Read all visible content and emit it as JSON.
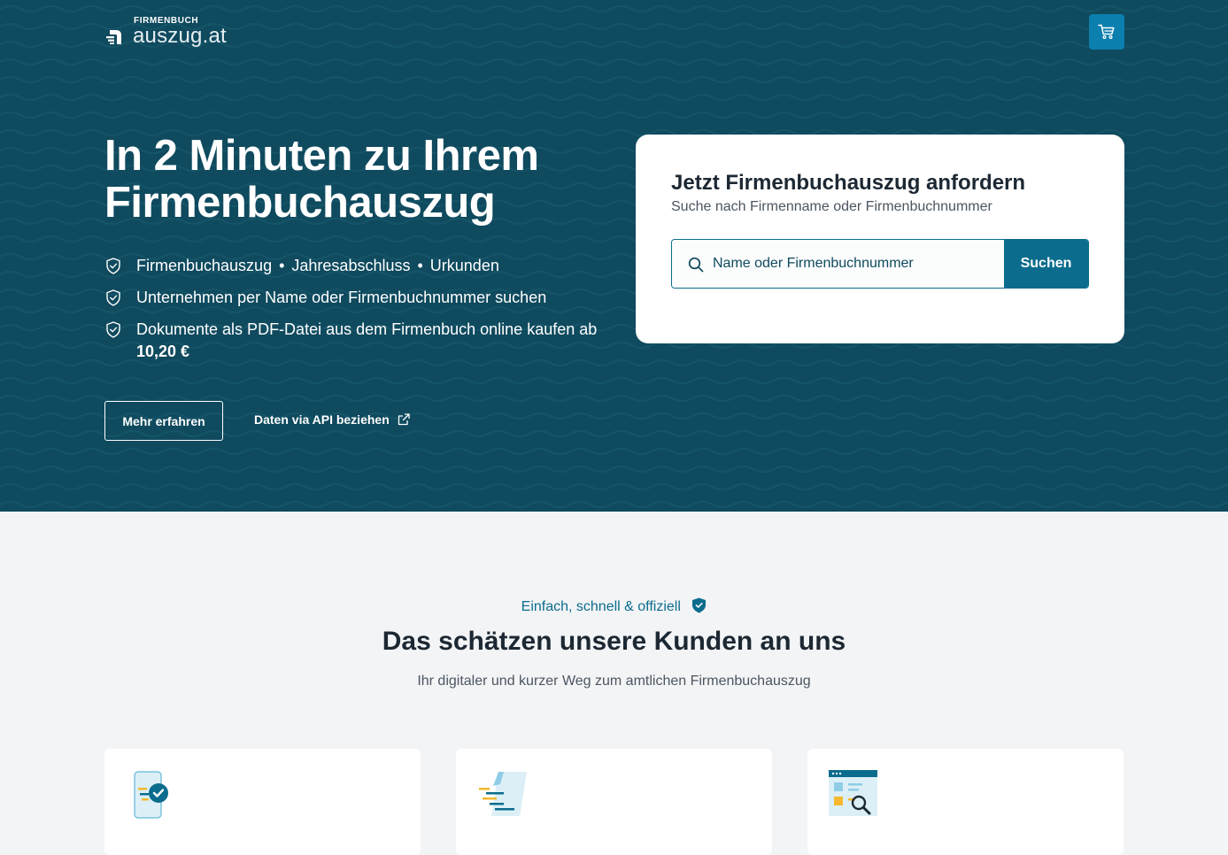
{
  "header": {
    "logo_small": "FIRMENBUCH",
    "logo_big": "auszug.at",
    "cart_icon": "shopping-cart-icon"
  },
  "hero": {
    "title_line1": "In 2 Minuten zu Ihrem",
    "title_line2": "Firmenbuchauszug",
    "features": [
      {
        "parts": [
          "Firmenbuchauszug",
          "Jahresabschluss",
          "Urkunden"
        ],
        "separator": "•"
      },
      {
        "text": "Unternehmen per Name oder Firmenbuchnummer suchen"
      },
      {
        "text": "Dokumente als PDF-Datei aus dem Firmenbuch online kaufen ab ",
        "price": "10,20 €"
      }
    ],
    "feature_icon": "shield-check-icon",
    "more_button": "Mehr erfahren",
    "api_link": "Daten via API beziehen",
    "api_link_icon": "external-link-icon"
  },
  "search_card": {
    "title": "Jetzt Firmenbuchauszug anfordern",
    "subtitle": "Suche nach Firmenname oder Firmenbuchnummer",
    "placeholder": "Name oder Firmenbuchnummer",
    "value": "",
    "button": "Suchen",
    "search_icon": "search-icon"
  },
  "section": {
    "eyebrow": "Einfach, schnell & offiziell",
    "eyebrow_icon": "shield-check-icon",
    "title": "Das schätzen unsere Kunden an uns",
    "subtitle": "Ihr digitaler und kurzer Weg zum amtlichen Firmenbuchauszug",
    "cards": [
      {
        "icon": "phone-check-icon"
      },
      {
        "icon": "fast-document-icon"
      },
      {
        "icon": "browser-search-icon"
      }
    ]
  },
  "colors": {
    "hero_background": "#0f4a5e",
    "primary": "#0b6c8d",
    "cart_button": "#0b7fae",
    "section_background": "#f3f4f6",
    "accent_yellow": "#f5b82e"
  }
}
